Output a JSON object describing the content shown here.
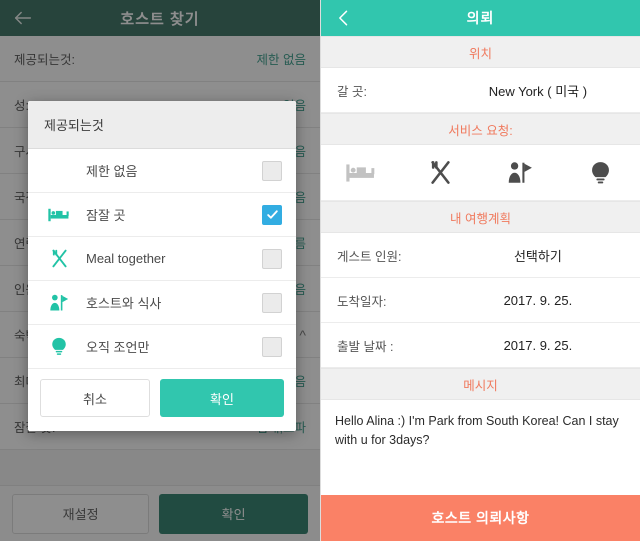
{
  "left": {
    "header": {
      "title": "호스트 찾기",
      "back_icon": "arrow-left-icon"
    },
    "rows": [
      {
        "label": "제공되는것:",
        "value": "제한 없음"
      },
      {
        "label": "성:",
        "value": "없음"
      },
      {
        "label": "구사 언어:",
        "value": "없음"
      },
      {
        "label": "국적:",
        "value": "없음"
      },
      {
        "label": "연령:",
        "value": "모름"
      },
      {
        "label": "인원:",
        "value": "없음"
      },
      {
        "label": "숙박:",
        "value": "^"
      },
      {
        "label": "최대 인원:",
        "value": "없음"
      },
      {
        "label": "잠잘 곳:",
        "value": "침대,소파"
      }
    ],
    "bottom": {
      "reset_label": "재설정",
      "confirm_label": "확인"
    }
  },
  "dialog": {
    "title": "제공되는것",
    "options": [
      {
        "icon": "none",
        "label": "제한 없음",
        "checked": false
      },
      {
        "icon": "bed-icon",
        "label": "잠잘 곳",
        "checked": true
      },
      {
        "icon": "cutlery-icon",
        "label": "Meal together",
        "checked": false
      },
      {
        "icon": "person-flag-icon",
        "label": "호스트와 식사",
        "checked": false
      },
      {
        "icon": "lightbulb-icon",
        "label": "오직 조언만",
        "checked": false
      }
    ],
    "cancel_label": "취소",
    "confirm_label": "확인"
  },
  "right": {
    "header": {
      "title": "의뢰",
      "back_icon": "chevron-left-icon"
    },
    "location_section": "위치",
    "location_row": {
      "label": "갈 곳:",
      "value": "New York ( 미국 )"
    },
    "services_section": "서비스 요청:",
    "services": [
      {
        "icon": "bed-icon",
        "active": false
      },
      {
        "icon": "cutlery-icon",
        "active": true
      },
      {
        "icon": "person-flag-icon",
        "active": true
      },
      {
        "icon": "lightbulb-icon",
        "active": true
      }
    ],
    "plan_section": "내 여행계획",
    "plan_rows": [
      {
        "label": "게스트 인원:",
        "value": "선택하기"
      },
      {
        "label": "도착일자:",
        "value": "2017. 9. 25."
      },
      {
        "label": "출발 날짜 :",
        "value": "2017. 9. 25."
      }
    ],
    "message_section": "메시지",
    "message_body": "Hello Alina :) I'm Park from South Korea! Can I stay with u for 3days?",
    "submit_label": "호스트 의뢰사항"
  },
  "colors": {
    "dark_green": "#1b5b4b",
    "teal": "#31c6ae",
    "coral": "#fa8166",
    "checkbox_blue": "#32ade2"
  }
}
